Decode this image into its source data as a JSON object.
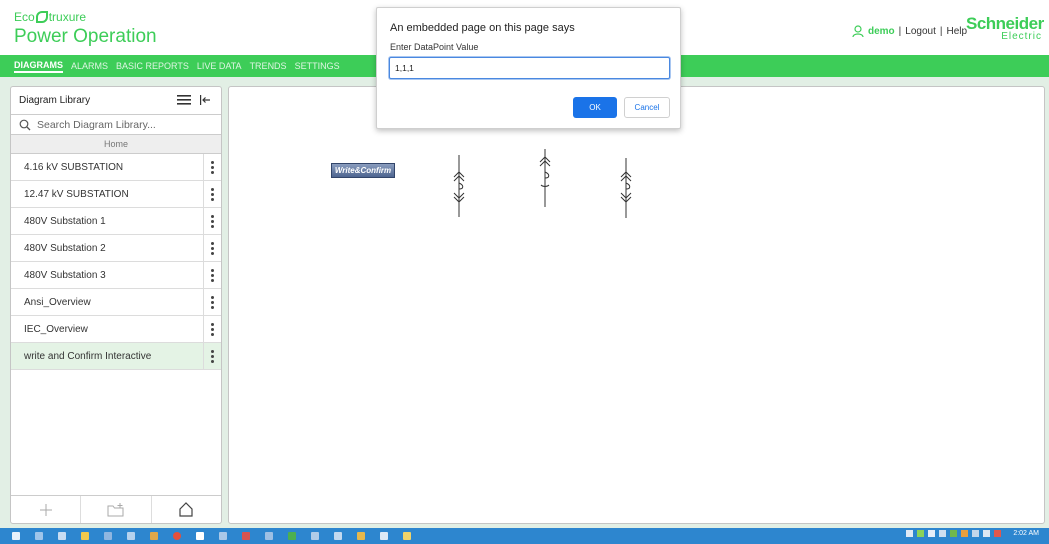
{
  "header": {
    "brand_eco": "Eco",
    "brand_struxure": "truxure",
    "app_title": "Power Operation",
    "username": "demo",
    "logout": "Logout",
    "help": "Help",
    "sep": "|",
    "logo_line1": "Schneider",
    "logo_line2": "Electric"
  },
  "nav": {
    "items": [
      "DIAGRAMS",
      "ALARMS",
      "BASIC REPORTS",
      "LIVE DATA",
      "TRENDS",
      "SETTINGS"
    ],
    "active": "DIAGRAMS"
  },
  "library": {
    "title": "Diagram Library",
    "search_placeholder": "Search Diagram Library...",
    "home_label": "Home",
    "items": [
      {
        "label": "4.16 kV SUBSTATION"
      },
      {
        "label": "12.47 kV SUBSTATION"
      },
      {
        "label": "480V Substation 1"
      },
      {
        "label": "480V Substation 2"
      },
      {
        "label": "480V Substation 3"
      },
      {
        "label": "Ansi_Overview"
      },
      {
        "label": "IEC_Overview"
      },
      {
        "label": "write and Confirm Interactive"
      }
    ],
    "selected_item": "write and Confirm Interactive"
  },
  "canvas": {
    "button_label": "Write&Confirm"
  },
  "dialog": {
    "title": "An embedded page on this page says",
    "message": "Enter DataPoint Value",
    "input_value": "1,1,1",
    "ok_label": "OK",
    "cancel_label": "Cancel"
  },
  "taskbar": {
    "clock": "2:02 AM"
  },
  "colors": {
    "brand_green": "#3dcd58",
    "content_bg": "#e2efe5",
    "dialog_blue": "#1a73e8",
    "taskbar_blue": "#2d86cf"
  }
}
